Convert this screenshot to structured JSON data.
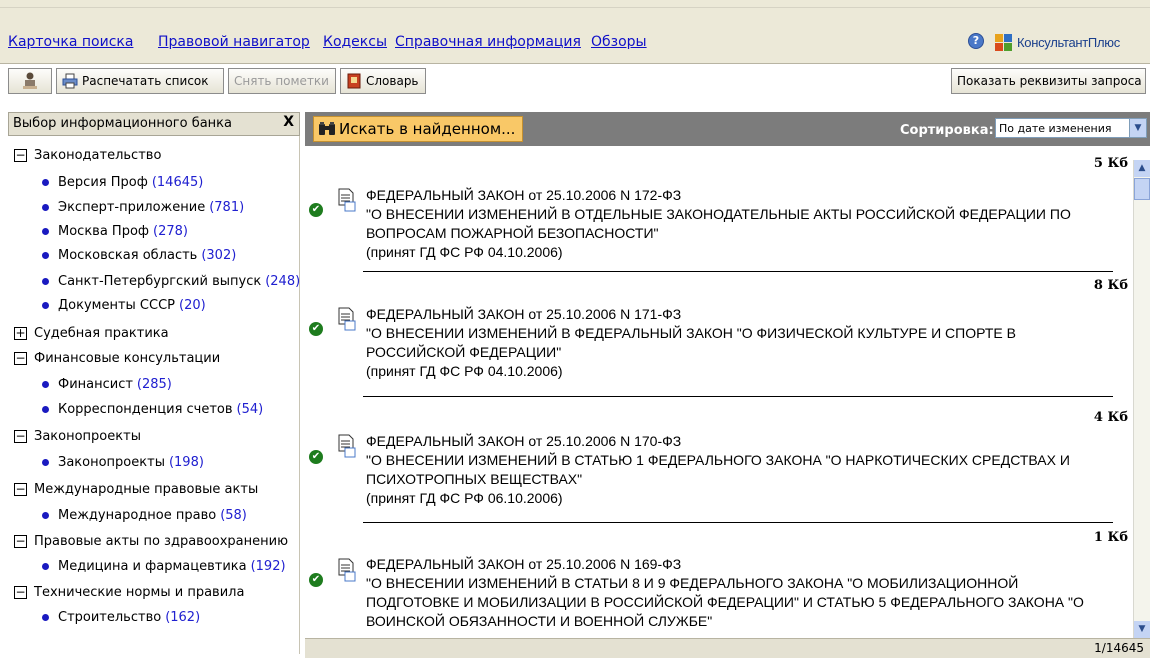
{
  "nav": {
    "links": [
      "Карточка поиска",
      "Правовой навигатор",
      "Кодексы",
      "Справочная информация",
      "Обзоры"
    ],
    "help_icon": "help-icon",
    "logo_text": "КонсультантПлюс",
    "logo_colors": [
      "#e8a21c",
      "#2f6fc4",
      "#d94a1c",
      "#4f9e2c"
    ]
  },
  "toolbar": {
    "print_label": "Распечатать список",
    "unmark_label": "Снять пометки",
    "dictionary_label": "Словарь",
    "show_query_label": "Показать реквизиты запроса"
  },
  "left": {
    "title": "Выбор информационного банка",
    "close_label": "X",
    "groups": [
      {
        "toggle": "−",
        "label": "Законодательство",
        "items": [
          {
            "label": "Версия Проф",
            "count": "(14645)"
          },
          {
            "label": "Эксперт-приложение",
            "count": "(781)"
          },
          {
            "label": "Москва Проф",
            "count": "(278)"
          },
          {
            "label": "Московская область",
            "count": "(302)"
          },
          {
            "label": "Санкт-Петербургский выпуск",
            "count": "(248)"
          },
          {
            "label": "Документы СССР",
            "count": "(20)"
          }
        ]
      },
      {
        "toggle": "+",
        "label": "Судебная практика",
        "items": []
      },
      {
        "toggle": "−",
        "label": "Финансовые консультации",
        "items": [
          {
            "label": "Финансист",
            "count": "(285)"
          },
          {
            "label": "Корреспонденция счетов",
            "count": "(54)"
          }
        ]
      },
      {
        "toggle": "−",
        "label": "Законопроекты",
        "items": [
          {
            "label": "Законопроекты",
            "count": "(198)"
          }
        ]
      },
      {
        "toggle": "−",
        "label": "Международные правовые акты",
        "items": [
          {
            "label": "Международное право",
            "count": "(58)"
          }
        ]
      },
      {
        "toggle": "−",
        "label": "Правовые акты по здравоохранению",
        "items": [
          {
            "label": "Медицина и фармацевтика",
            "count": "(192)"
          }
        ]
      },
      {
        "toggle": "−",
        "label": "Технические нормы и правила",
        "items": [
          {
            "label": "Строительство",
            "count": "(162)"
          }
        ]
      }
    ]
  },
  "results": {
    "search_in_found_label": "Искать в найденном...",
    "sort_label": "Сортировка:",
    "sort_value": "По дате изменения",
    "documents": [
      {
        "size": "5 Кб",
        "lines": [
          "ФЕДЕРАЛЬНЫЙ ЗАКОН от 25.10.2006 N 172-ФЗ",
          "\"О ВНЕСЕНИИ ИЗМЕНЕНИЙ В ОТДЕЛЬНЫЕ ЗАКОНОДАТЕЛЬНЫЕ АКТЫ РОССИЙСКОЙ ФЕДЕРАЦИИ ПО",
          "ВОПРОСАМ ПОЖАРНОЙ БЕЗОПАСНОСТИ\"",
          "(принят ГД ФС РФ 04.10.2006)"
        ]
      },
      {
        "size": "8 Кб",
        "lines": [
          "ФЕДЕРАЛЬНЫЙ ЗАКОН от 25.10.2006 N 171-ФЗ",
          "\"О ВНЕСЕНИИ ИЗМЕНЕНИЙ В ФЕДЕРАЛЬНЫЙ ЗАКОН \"О ФИЗИЧЕСКОЙ КУЛЬТУРЕ И СПОРТЕ В",
          "РОССИЙСКОЙ ФЕДЕРАЦИИ\"",
          "(принят ГД ФС РФ 04.10.2006)"
        ]
      },
      {
        "size": "4 Кб",
        "lines": [
          "ФЕДЕРАЛЬНЫЙ ЗАКОН от 25.10.2006 N 170-ФЗ",
          "\"О ВНЕСЕНИИ ИЗМЕНЕНИЙ В СТАТЬЮ 1 ФЕДЕРАЛЬНОГО ЗАКОНА \"О НАРКОТИЧЕСКИХ СРЕДСТВАХ И",
          "ПСИХОТРОПНЫХ ВЕЩЕСТВАХ\"",
          "(принят ГД ФС РФ 06.10.2006)"
        ]
      },
      {
        "size": "1 Кб",
        "lines": [
          "ФЕДЕРАЛЬНЫЙ ЗАКОН от 25.10.2006 N 169-ФЗ",
          "\"О ВНЕСЕНИИ ИЗМЕНЕНИЙ В СТАТЬИ 8 И 9 ФЕДЕРАЛЬНОГО ЗАКОНА \"О МОБИЛИЗАЦИОННОЙ",
          "ПОДГОТОВКЕ И МОБИЛИЗАЦИИ В РОССИЙСКОЙ ФЕДЕРАЦИИ\" И СТАТЬЮ 5 ФЕДЕРАЛЬНОГО ЗАКОНА \"О",
          "ВОИНСКОЙ ОБЯЗАННОСТИ И ВОЕННОЙ СЛУЖБЕ\""
        ]
      }
    ],
    "page_counter": "1/14645"
  },
  "colors": {
    "header_gray": "#7c7c7c",
    "search_button": "#f9c867",
    "link_blue": "#1010c8",
    "check_green": "#1e7c1e"
  }
}
